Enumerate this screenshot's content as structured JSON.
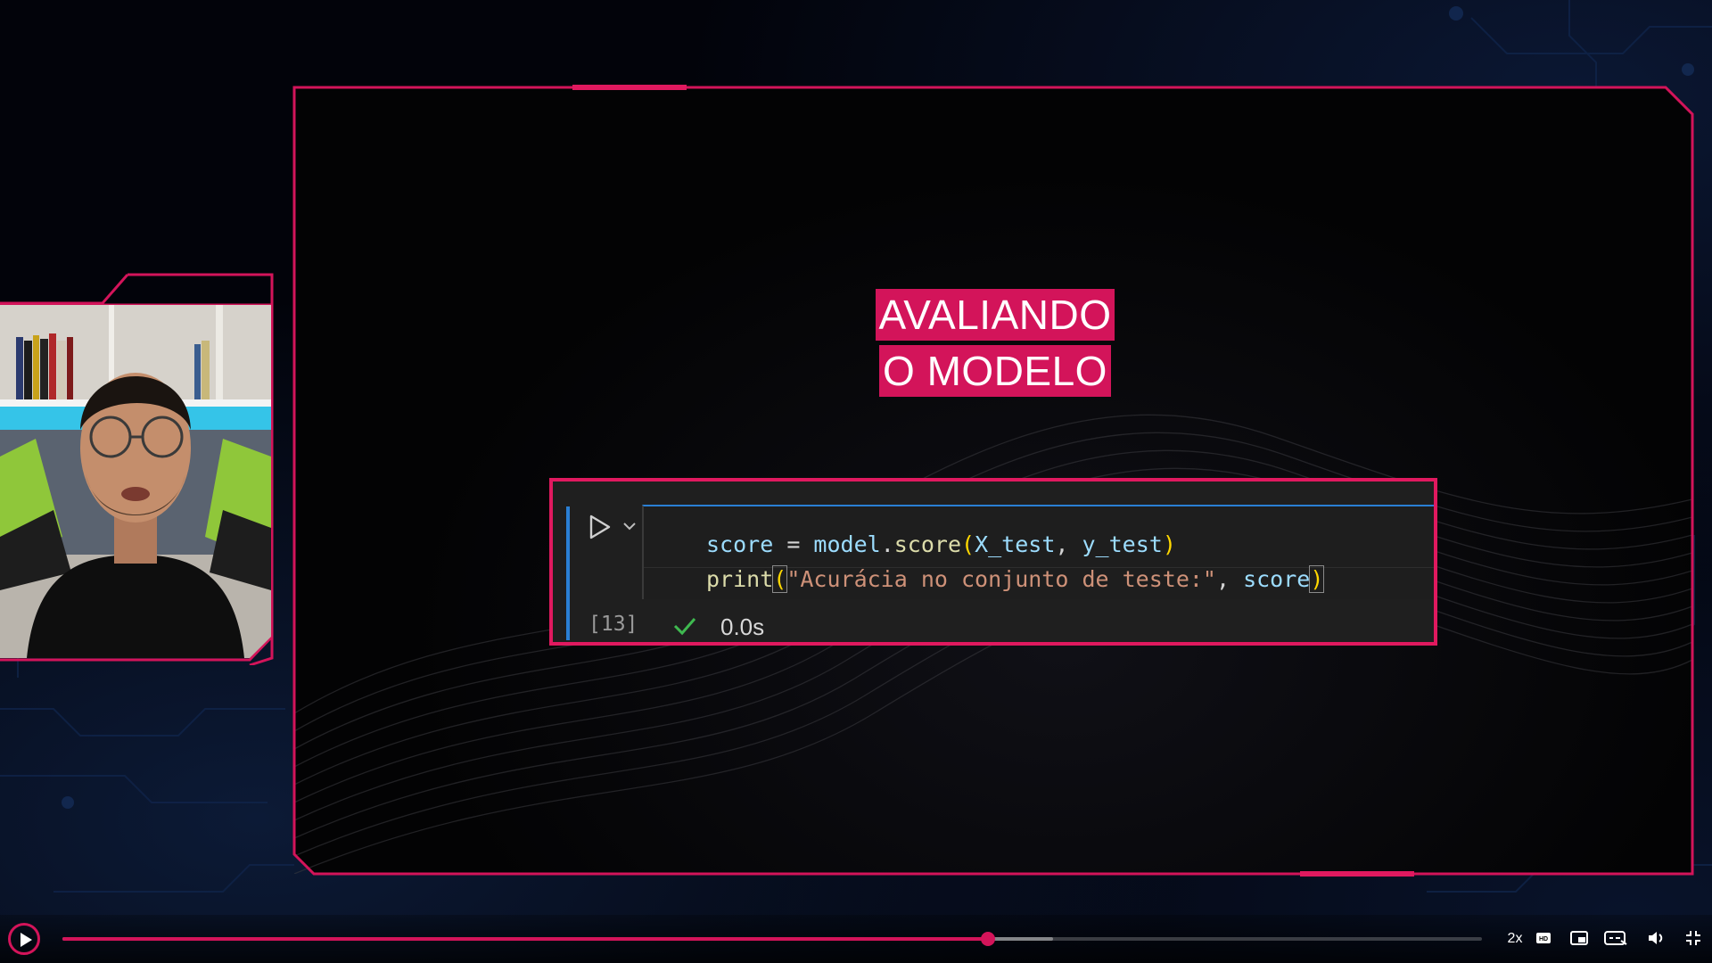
{
  "slide": {
    "title_line1": "AVALIANDO",
    "title_line2": "O MODELO"
  },
  "code_cell": {
    "execution_count": "[13]",
    "execution_time": "0.0s",
    "line1": {
      "var": "score",
      "op": " = ",
      "obj": "model",
      "dot": ".",
      "method": "score",
      "open": "(",
      "arg1": "X_test",
      "comma": ", ",
      "arg2": "y_test",
      "close": ")"
    },
    "line2": {
      "fn": "print",
      "open": "(",
      "string": "\"Acurácia no conjunto de teste:\"",
      "comma": ", ",
      "arg": "score",
      "close": ")"
    }
  },
  "player": {
    "progress": 0.652,
    "buffered": 0.698,
    "speed_label": "2x"
  },
  "icons": {
    "run": "play-triangle-icon",
    "expand": "chevron-down-icon",
    "success": "checkmark-icon",
    "player_play": "play-icon",
    "hd": "hd-icon",
    "pip": "picture-in-picture-icon",
    "captions": "captions-icon",
    "volume": "volume-icon",
    "fullscreen": "exit-fullscreen-icon"
  },
  "colors": {
    "accent": "#d3145a",
    "frame": "#e0195f",
    "cell_border": "#2a7fd4",
    "success": "#3fb950"
  }
}
